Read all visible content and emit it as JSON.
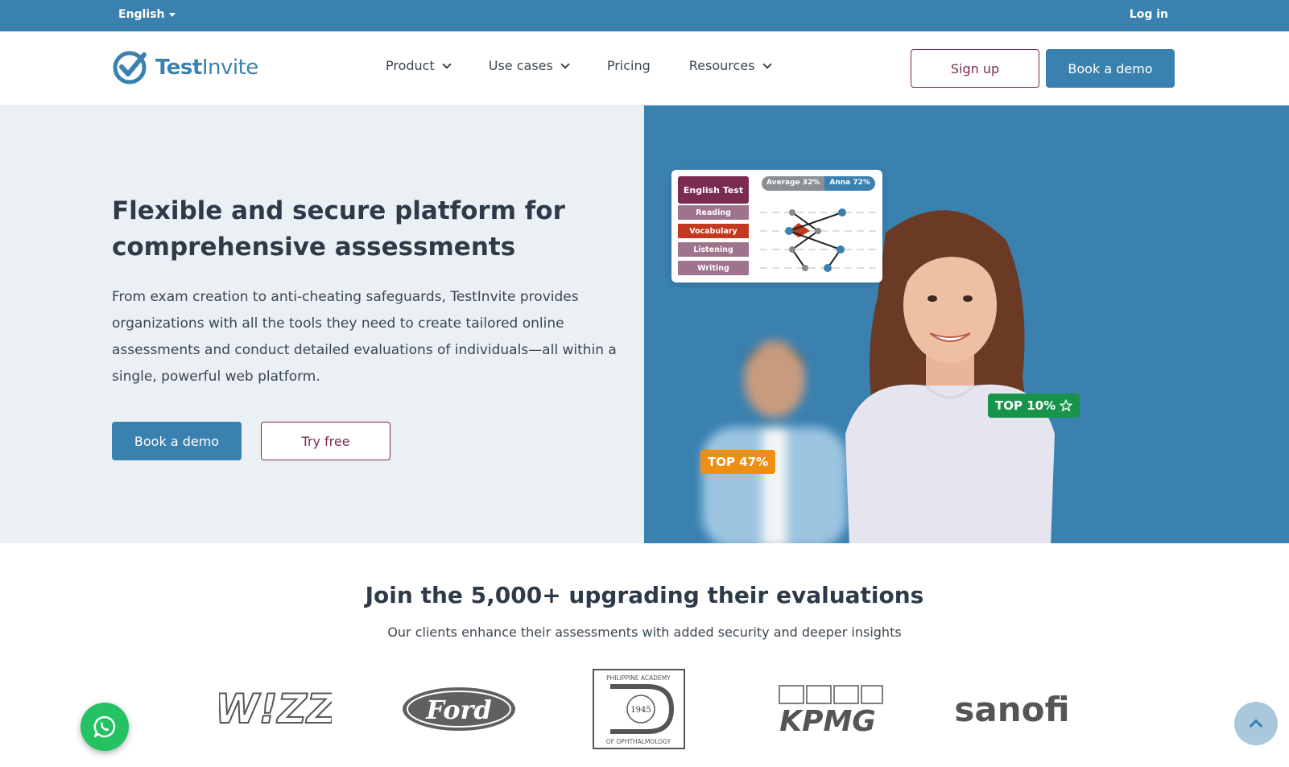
{
  "topbar": {
    "language": "English",
    "login": "Log in"
  },
  "brand": {
    "name_bold": "Test",
    "name_light": "Invite"
  },
  "nav": {
    "items": [
      {
        "label": "Product",
        "has_dropdown": true
      },
      {
        "label": "Use cases",
        "has_dropdown": true
      },
      {
        "label": "Pricing",
        "has_dropdown": false
      },
      {
        "label": "Resources",
        "has_dropdown": true
      }
    ],
    "signup": "Sign up",
    "book_demo": "Book a demo"
  },
  "hero": {
    "title": "Flexible and secure platform for comprehensive assessments",
    "description": "From exam creation to anti-cheating safeguards, TestInvite provides organizations with all the tools they need to create tailored online assessments and conduct detailed evaluations of individuals—all within a single, powerful web platform.",
    "book_demo": "Book a demo",
    "try_free": "Try free"
  },
  "illustration": {
    "card_title": "English Test",
    "legend_average": "Average 32%",
    "legend_anna": "Anna 72%",
    "skills": [
      "Reading",
      "Vocabulary",
      "Listening",
      "Writing"
    ],
    "active_skill": "Vocabulary",
    "badge_left": "TOP 47%",
    "badge_right": "TOP 10%"
  },
  "clients": {
    "title": "Join the 5,000+ upgrading their evaluations",
    "subtitle": "Our clients enhance their assessments with added security and deeper insights",
    "logos": {
      "wizz": "W!ZZ",
      "ford": "Ford",
      "paoph_top": "PHILIPPINE ACADEMY",
      "paoph_year": "1945",
      "paoph_bottom": "OF OPHTHALMOLOGY",
      "kpmg": "KPMG",
      "sanofi": "sanofi"
    }
  },
  "colors": {
    "brand_blue": "#3a81b0",
    "brand_plum": "#7a2b52",
    "hero_bg": "#eaf0f4",
    "badge_orange": "#ef8f12",
    "badge_green": "#17934a",
    "whatsapp_green": "#25c263"
  }
}
